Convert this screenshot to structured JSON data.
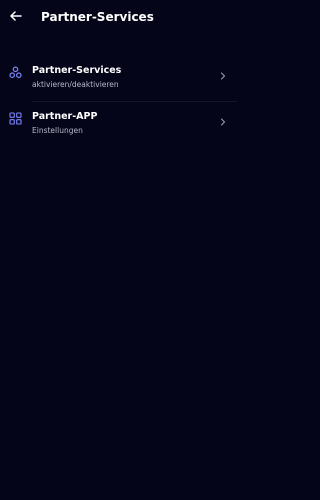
{
  "header": {
    "title": "Partner-Services",
    "back_icon": "arrow-left-icon"
  },
  "list": {
    "items": [
      {
        "title": "Partner-Services",
        "subtitle": "aktivieren/deaktivieren",
        "icon": "services-cluster-icon"
      },
      {
        "title": "Partner-APP",
        "subtitle": "Einstellungen",
        "icon": "app-grid-icon"
      }
    ]
  },
  "colors": {
    "background": "#05051a",
    "accent_icon": "#7e87ff",
    "subtitle": "#b8b9c8",
    "chevron": "#9a9aa8"
  }
}
